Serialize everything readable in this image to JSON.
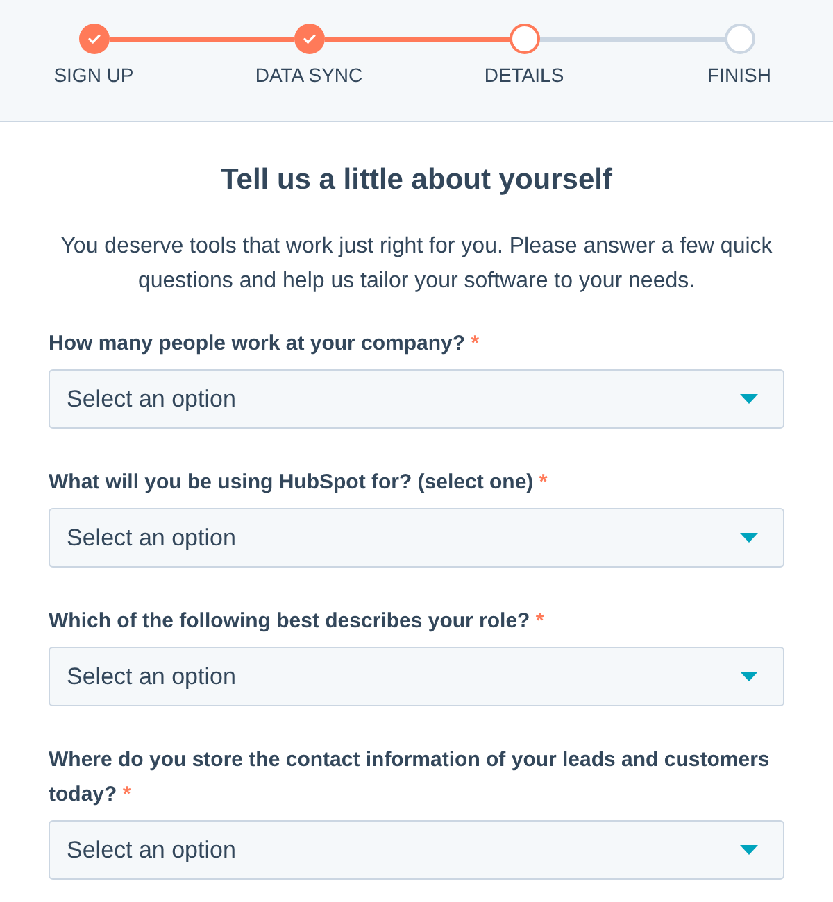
{
  "steps": [
    {
      "label": "SIGN UP",
      "completed": true,
      "selected": false
    },
    {
      "label": "DATA SYNC",
      "completed": true,
      "selected": false
    },
    {
      "label": "DETAILS",
      "completed": false,
      "selected": true
    },
    {
      "label": "FINISH",
      "completed": false,
      "selected": false
    }
  ],
  "heading": "Tell us a little about yourself",
  "intro": "You deserve tools that work just right for you. Please answer a few quick questions and help us tailor your software to your needs.",
  "questions": [
    {
      "label": "How many people work at your company?",
      "required_mark": "*",
      "placeholder": "Select an option"
    },
    {
      "label": "What will you be using HubSpot for? (select one)",
      "required_mark": "*",
      "placeholder": "Select an option"
    },
    {
      "label": "Which of the following best describes your role?",
      "required_mark": "*",
      "placeholder": "Select an option"
    },
    {
      "label": "Where do you store the contact information of your leads and customers today?",
      "required_mark": "*",
      "placeholder": "Select an option"
    }
  ]
}
